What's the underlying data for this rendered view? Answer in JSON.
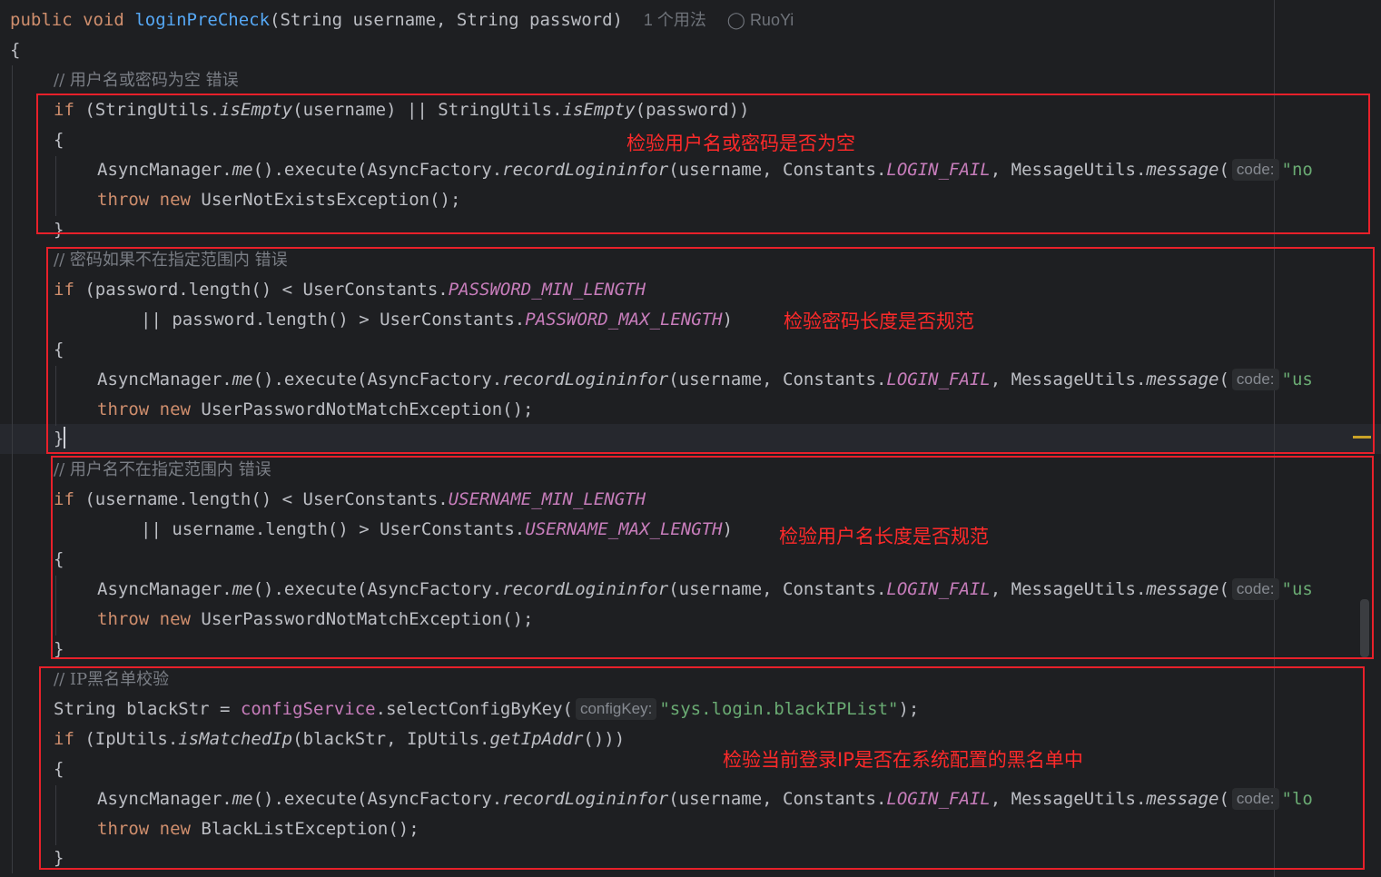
{
  "signature": {
    "text": "public void loginPreCheck(String username, String password)",
    "public": "public",
    "void": "void",
    "name": "loginPreCheck",
    "params": "(String username, String password)",
    "usages": "1 个用法",
    "author": "RuoYi"
  },
  "open_brace": "{",
  "block1": {
    "comment": "// 用户名或密码为空 错误",
    "if_kw": "if",
    "cond_a": " (StringUtils.",
    "m1": "isEmpty",
    "cond_b": "(username) || StringUtils.",
    "m2": "isEmpty",
    "cond_c": "(password))",
    "open": "{",
    "exec": "AsyncManager.",
    "me": "me",
    "exec2": "().execute(AsyncFactory.",
    "rec": "recordLogininfor",
    "exec3": "(username, Constants.",
    "lf": "LOGIN_FAIL",
    "exec4": ", MessageUtils.",
    "msg": "message",
    "exec5": "(",
    "hint": "code:",
    "str": "\"no",
    "throw_kw": "throw",
    "new_kw": "new",
    "throw_rest": " UserNotExistsException();",
    "close": "}",
    "note": "检验用户名或密码是否为空"
  },
  "block2": {
    "comment": "// 密码如果不在指定范围内 错误",
    "if_kw": "if",
    "cond_a": " (password.length() < UserConstants.",
    "c1": "PASSWORD_MIN_LENGTH",
    "cond_b": "|| password.length() > UserConstants.",
    "c2": "PASSWORD_MAX_LENGTH",
    "cond_c": ")",
    "open": "{",
    "exec": "AsyncManager.",
    "me": "me",
    "exec2": "().execute(AsyncFactory.",
    "rec": "recordLogininfor",
    "exec3": "(username, Constants.",
    "lf": "LOGIN_FAIL",
    "exec4": ", MessageUtils.",
    "msg": "message",
    "exec5": "(",
    "hint": "code:",
    "str": "\"us",
    "throw_kw": "throw",
    "new_kw": "new",
    "throw_rest": " UserPasswordNotMatchException();",
    "close": "}",
    "note": "检验密码长度是否规范"
  },
  "block3": {
    "comment": "// 用户名不在指定范围内 错误",
    "if_kw": "if",
    "cond_a": " (username.length() < UserConstants.",
    "c1": "USERNAME_MIN_LENGTH",
    "cond_b": "|| username.length() > UserConstants.",
    "c2": "USERNAME_MAX_LENGTH",
    "cond_c": ")",
    "open": "{",
    "exec": "AsyncManager.",
    "me": "me",
    "exec2": "().execute(AsyncFactory.",
    "rec": "recordLogininfor",
    "exec3": "(username, Constants.",
    "lf": "LOGIN_FAIL",
    "exec4": ", MessageUtils.",
    "msg": "message",
    "exec5": "(",
    "hint": "code:",
    "str": "\"us",
    "throw_kw": "throw",
    "new_kw": "new",
    "throw_rest": " UserPasswordNotMatchException();",
    "close": "}",
    "note": "检验用户名长度是否规范"
  },
  "block4": {
    "comment": "// IP黑名单校验",
    "decl_a": "String blackStr = ",
    "field": "configService",
    "decl_b": ".selectConfigByKey(",
    "hint_key": "configKey:",
    "key_str": "\"sys.login.blackIPList\"",
    "decl_c": ");",
    "if_kw": "if",
    "cond_a": " (IpUtils.",
    "m1": "isMatchedIp",
    "cond_b": "(blackStr, IpUtils.",
    "m2": "getIpAddr",
    "cond_c": "()))",
    "open": "{",
    "exec": "AsyncManager.",
    "me": "me",
    "exec2": "().execute(AsyncFactory.",
    "rec": "recordLogininfor",
    "exec3": "(username, Constants.",
    "lf": "LOGIN_FAIL",
    "exec4": ", MessageUtils.",
    "msg": "message",
    "exec5": "(",
    "hint": "code:",
    "str": "\"lo",
    "throw_kw": "throw",
    "new_kw": "new",
    "throw_rest": " BlackListException();",
    "close": "}",
    "note": "检验当前登录IP是否在系统配置的黑名单中"
  },
  "colors": {
    "background": "#1e1f22",
    "keyword": "#cf8e6d",
    "method": "#56a8f5",
    "constant": "#c77dbb",
    "string": "#6aab73",
    "comment": "#7a7e85",
    "annotation_red": "#e8202a"
  }
}
